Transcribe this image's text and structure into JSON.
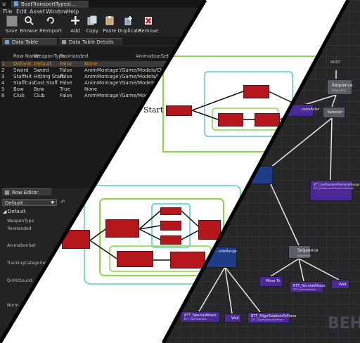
{
  "editor": {
    "tab_title": "BoatTransportTypesI...",
    "menu": [
      "File",
      "Edit",
      "Asset",
      "Window",
      "Help"
    ],
    "toolbar": [
      {
        "label": "Save",
        "icon": "save-icon"
      },
      {
        "label": "Browse",
        "icon": "browse-icon"
      },
      {
        "label": "Reimport",
        "icon": "reimport-icon"
      },
      {
        "label": "Add",
        "icon": "add-icon"
      },
      {
        "label": "Copy",
        "icon": "copy-icon"
      },
      {
        "label": "Paste",
        "icon": "paste-icon"
      },
      {
        "label": "Duplicate",
        "icon": "duplicate-icon"
      },
      {
        "label": "Remove",
        "icon": "remove-icon"
      }
    ],
    "tabs": [
      "Data Table",
      "Data Table Details"
    ],
    "columns": [
      "Row Name",
      "WeaponType",
      "TwoHanded",
      "AnimationSet"
    ],
    "rows": [
      {
        "index": "1",
        "name": "Default",
        "type": "Default",
        "two": "False",
        "anim": "None"
      },
      {
        "index": "2",
        "name": "Sword",
        "type": "Sword",
        "two": "False",
        "anim": "AnimMontage'/Game/Models/Chonkie"
      },
      {
        "index": "3",
        "name": "StaffHit",
        "type": "Hitting Staff",
        "two": "False",
        "anim": "AnimMontage'/Game/Models/Chonkie"
      },
      {
        "index": "4",
        "name": "StaffCast",
        "type": "Cast Staff",
        "two": "False",
        "anim": "AnimMontage'/Game/Models/Chonkie"
      },
      {
        "index": "5",
        "name": "Bow",
        "type": "Bow",
        "two": "True",
        "anim": "None"
      },
      {
        "index": "6",
        "name": "Club",
        "type": "Club",
        "two": "False",
        "anim": "AnimMontage'/Game/Models/Chonkie"
      }
    ],
    "row_editor": {
      "title": "Row Editor",
      "selected": "Default",
      "section": "Default",
      "fields": [
        "WeaponType",
        "TwoHanded",
        "AnimationSet",
        "TrackingCategories",
        "OnHitSound",
        "Norm"
      ]
    }
  },
  "diagram": {
    "start_label": "Start",
    "colors": {
      "box": "#b3171c",
      "green": "#8bd64a",
      "cyan": "#58c8d0"
    }
  },
  "bt": {
    "nodes": {
      "root": "ROOT",
      "sequence_top": "Sequence",
      "sequence_top_sub": "Sequence",
      "actor": "...ovesActor",
      "selector": "Selector",
      "range": "...sideRange",
      "get_random": "BTT_GetRandomPositionInRange",
      "get_random_sub": "BTT_GetRandomPositionInRange",
      "sequence_mid": "Sequence",
      "sequence_mid_sub": "Sequence",
      "move_to": "Move To",
      "normal_attack": "BTT_NormalAttack",
      "normal_attack_sub": "BTT_NormalAttack",
      "wait": "Wait",
      "special_attack": "BTT_SpecialAttack",
      "special_attack_sub": "BTT_SpecialAttack",
      "wait2": "Wait",
      "align": "BTT_AlignRotationToPlane",
      "align_sub": "BTT_AlignRotationToPlane"
    },
    "watermark": "BEH"
  }
}
